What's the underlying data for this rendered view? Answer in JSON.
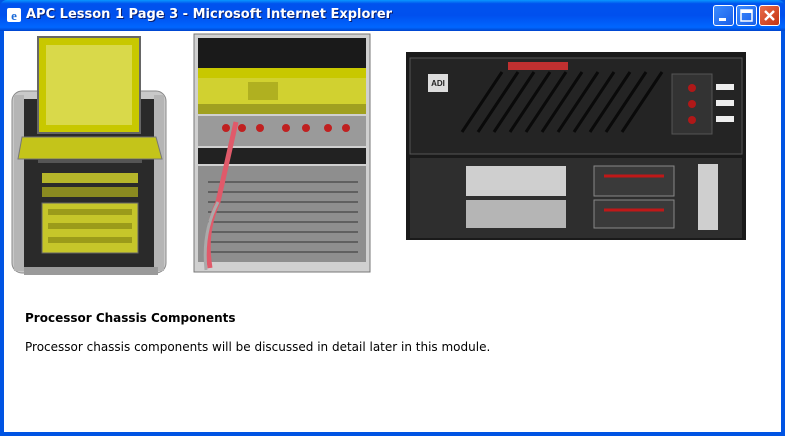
{
  "window": {
    "title": "APC Lesson 1 Page 3 - Microsoft Internet Explorer"
  },
  "content": {
    "heading": "Processor Chassis Components",
    "description": "Processor chassis components will be discussed in detail later in this module.",
    "rack_logo_text": "ADI"
  },
  "colors": {
    "titlebar": "#0054e3",
    "highlight": "#e6e600",
    "close": "#d8401c"
  }
}
